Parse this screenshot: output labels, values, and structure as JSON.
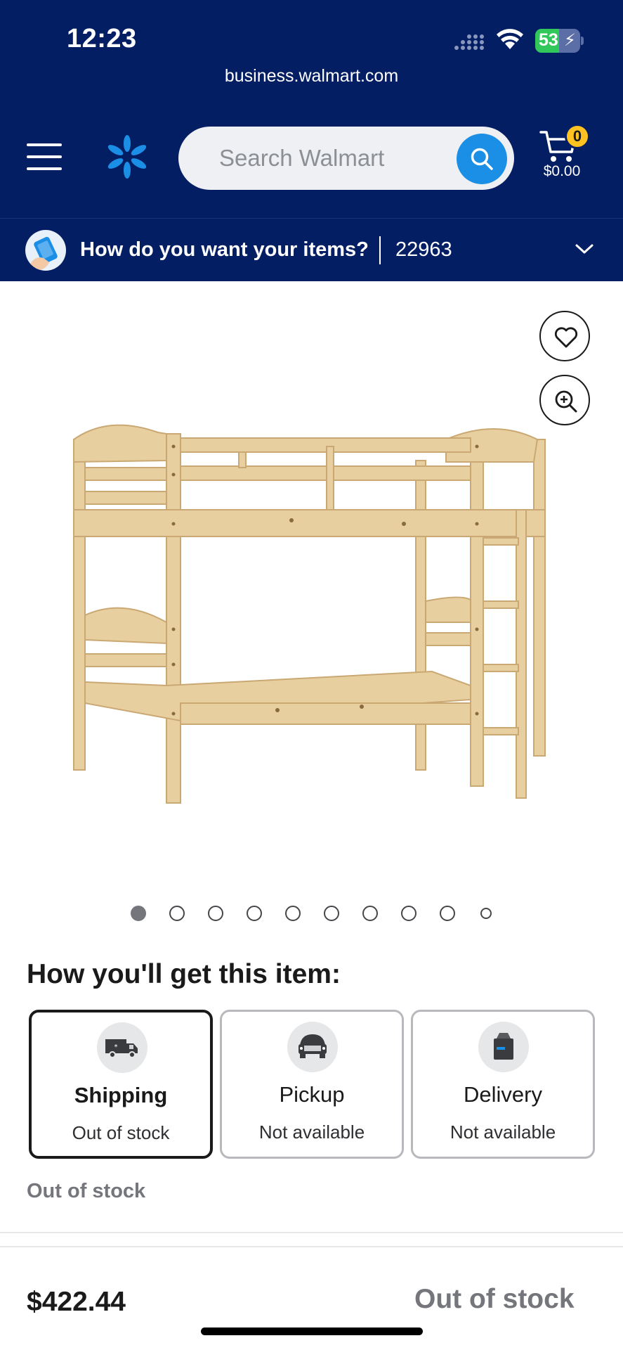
{
  "status_bar": {
    "time": "12:23",
    "battery": "53",
    "battery_level": 0.53,
    "charging": true
  },
  "browser": {
    "url": "business.walmart.com"
  },
  "header": {
    "menu_icon": "hamburger-menu-icon",
    "logo_icon": "walmart-spark-icon",
    "search": {
      "placeholder": "Search Walmart",
      "value": ""
    },
    "cart": {
      "count": "0",
      "total": "$0.00"
    },
    "colors": {
      "brand_navy": "#041e63",
      "brand_blue": "#1b8ee6",
      "badge_yellow": "#ffc220"
    }
  },
  "intent_bar": {
    "label": "How do you want your items?",
    "zip": "22963",
    "icon": "shopping-intent-icon"
  },
  "product": {
    "image_alt": "Wooden twin bunk bed",
    "actions": [
      "favorite-heart-icon",
      "zoom-in-icon"
    ],
    "carousel": {
      "total": 10,
      "active_index": 0
    }
  },
  "fulfillment": {
    "title": "How you'll get this item:",
    "options": [
      {
        "title": "Shipping",
        "status": "Out of stock",
        "icon": "shipping-truck-icon",
        "selected": true
      },
      {
        "title": "Pickup",
        "status": "Not available",
        "icon": "pickup-car-icon",
        "selected": false
      },
      {
        "title": "Delivery",
        "status": "Not available",
        "icon": "delivery-bag-icon",
        "selected": false
      }
    ],
    "note": "Out of stock"
  },
  "bottom_bar": {
    "price": "$422.44",
    "cta_status": "Out of stock"
  }
}
